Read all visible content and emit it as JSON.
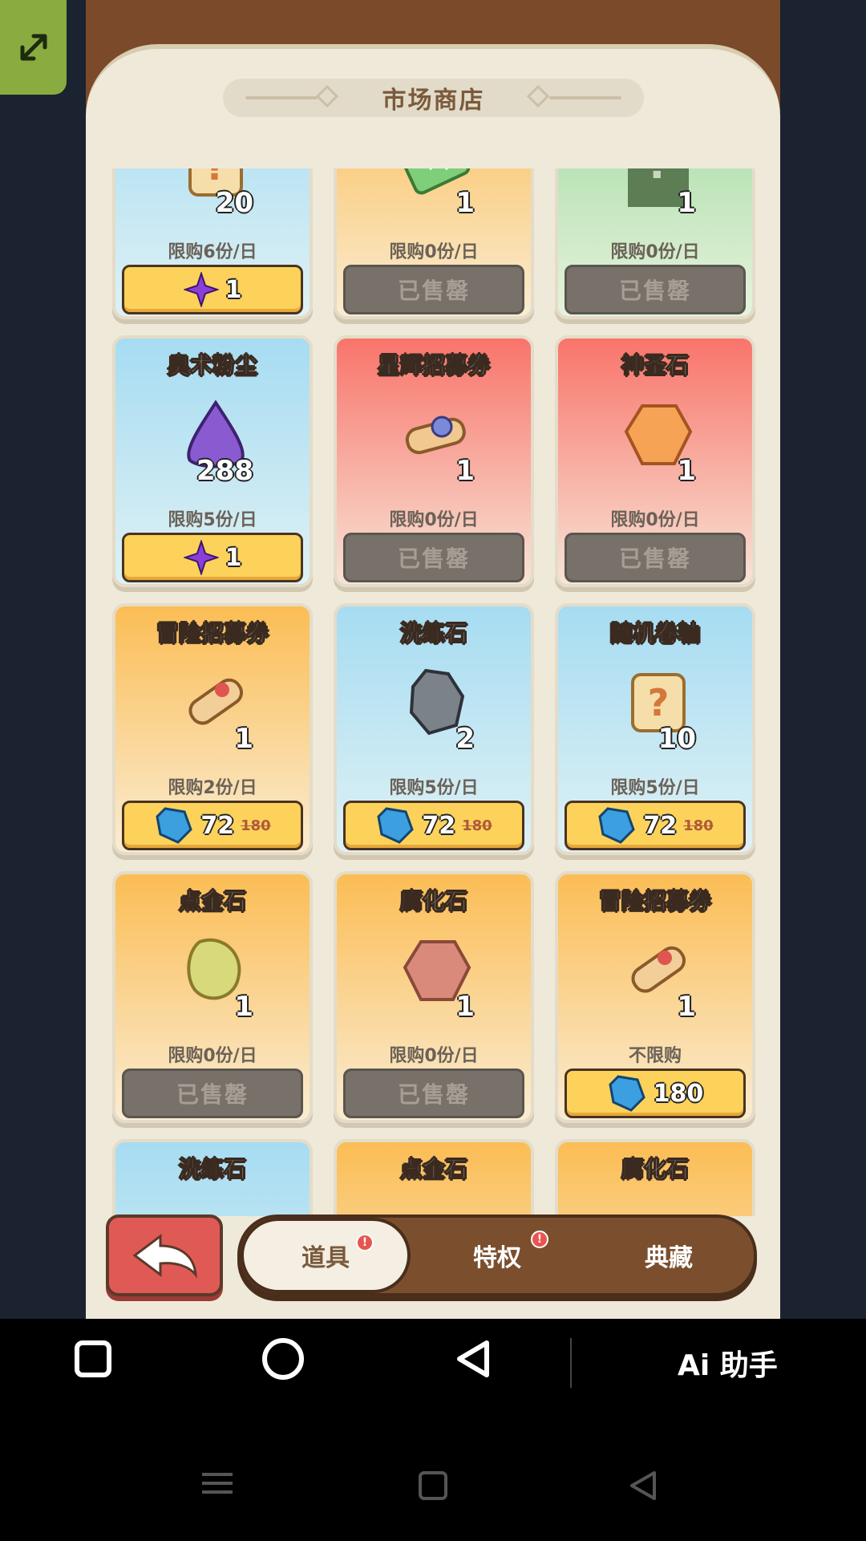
{
  "shop": {
    "title": "市场商店"
  },
  "items_top_row": [
    {
      "qty": "20",
      "limit": "限购6份/日",
      "status": "buy",
      "price": "1",
      "currency": "arcane-star-icon",
      "color": "blue",
      "icon": "scroll-question-icon"
    },
    {
      "qty": "1",
      "limit": "限购0份/日",
      "status": "sold",
      "sold_label": "已售罄",
      "color": "gold",
      "icon": "green-ticket-icon"
    },
    {
      "qty": "1",
      "limit": "限购0份/日",
      "status": "sold",
      "sold_label": "已售罄",
      "color": "green",
      "icon": "mystery-box-icon"
    }
  ],
  "items": [
    {
      "name": "奥术粉尘",
      "qty": "288",
      "limit": "限购5份/日",
      "status": "buy",
      "price": "1",
      "currency": "arcane-star-icon",
      "color": "blue",
      "icon": "purple-dust-icon"
    },
    {
      "name": "星辉招募券",
      "qty": "1",
      "limit": "限购0份/日",
      "status": "sold",
      "sold_label": "已售罄",
      "color": "red",
      "icon": "star-scroll-icon"
    },
    {
      "name": "神圣石",
      "qty": "1",
      "limit": "限购0份/日",
      "status": "sold",
      "sold_label": "已售罄",
      "color": "red",
      "icon": "orange-gem-icon"
    },
    {
      "name": "冒险招募券",
      "qty": "1",
      "limit": "限购2份/日",
      "status": "buy",
      "price": "72",
      "orig_price": "180",
      "currency": "blue-crystal-icon",
      "color": "gold",
      "icon": "adventure-scroll-icon"
    },
    {
      "name": "洗练石",
      "qty": "2",
      "limit": "限购5份/日",
      "status": "buy",
      "price": "72",
      "orig_price": "180",
      "currency": "blue-crystal-icon",
      "color": "blue",
      "icon": "gray-rock-icon"
    },
    {
      "name": "随机卷轴",
      "qty": "10",
      "limit": "限购5份/日",
      "status": "buy",
      "price": "72",
      "orig_price": "180",
      "currency": "blue-crystal-icon",
      "color": "blue",
      "icon": "scroll-question-icon"
    },
    {
      "name": "点金石",
      "qty": "1",
      "limit": "限购0份/日",
      "status": "sold",
      "sold_label": "已售罄",
      "color": "gold",
      "icon": "gold-stone-icon"
    },
    {
      "name": "腐化石",
      "qty": "1",
      "limit": "限购0份/日",
      "status": "sold",
      "sold_label": "已售罄",
      "color": "gold",
      "icon": "red-stone-icon"
    },
    {
      "name": "冒险招募券",
      "qty": "1",
      "limit": "不限购",
      "status": "buy",
      "price": "180",
      "currency": "blue-crystal-icon",
      "color": "gold",
      "icon": "adventure-scroll-icon"
    }
  ],
  "items_bottom_peek": [
    {
      "name": "洗练石",
      "color": "blue"
    },
    {
      "name": "点金石",
      "color": "gold"
    },
    {
      "name": "腐化石",
      "color": "gold"
    }
  ],
  "tabs": [
    {
      "label": "道具",
      "active": true,
      "badge": "!"
    },
    {
      "label": "特权",
      "active": false,
      "badge": "!"
    },
    {
      "label": "典藏",
      "active": false
    }
  ],
  "system_nav": {
    "assistant_label": "Ai 助手"
  }
}
